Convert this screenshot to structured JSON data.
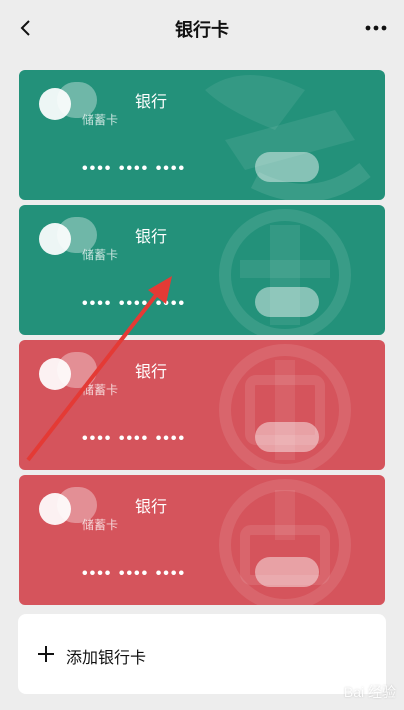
{
  "header": {
    "title": "银行卡"
  },
  "cards": [
    {
      "name": "银行",
      "type": "储蓄卡",
      "number": "•••• •••• ••••",
      "color": "#23917a"
    },
    {
      "name": "银行",
      "type": "储蓄卡",
      "number": "•••• •••• ••••",
      "color": "#23917a"
    },
    {
      "name": "银行",
      "type": "储蓄卡",
      "number": "•••• •••• ••••",
      "color": "#d5545c"
    },
    {
      "name": "银行",
      "type": "储蓄卡",
      "number": "•••• •••• ••••",
      "color": "#d5545c"
    }
  ],
  "add_card": {
    "label": "添加银行卡"
  },
  "watermark": {
    "text": "Bai 经验"
  },
  "colors": {
    "background": "#ededed",
    "arrow": "#e43a35"
  }
}
